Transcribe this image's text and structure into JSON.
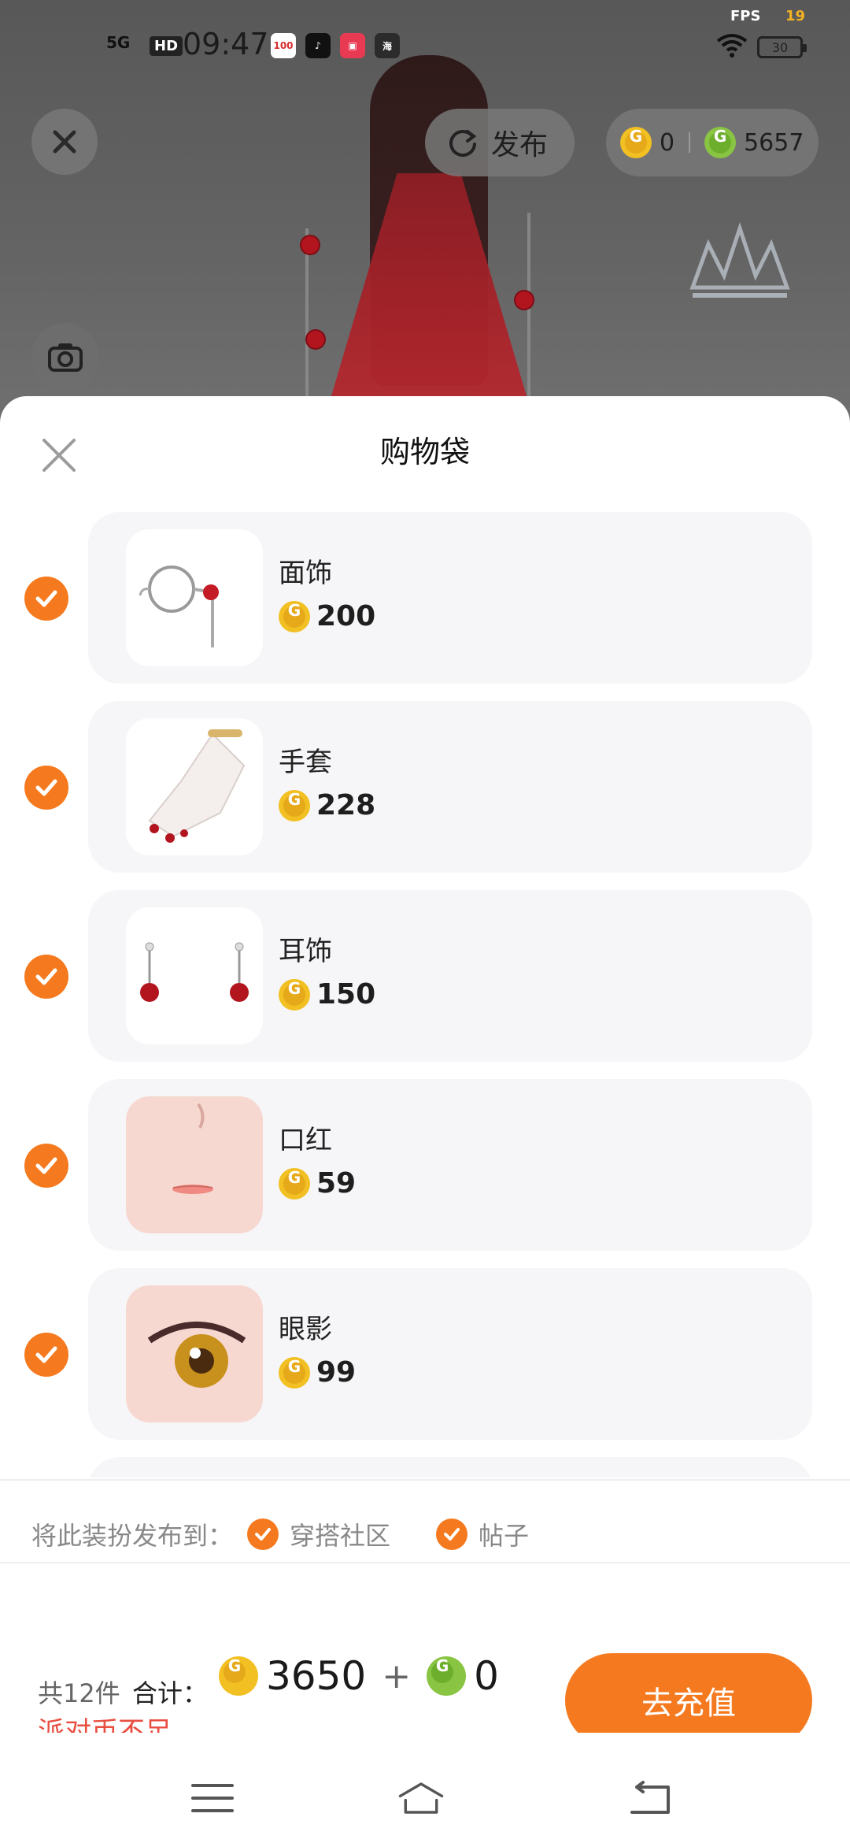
{
  "status_bar": {
    "network": "5G",
    "hd": "HD",
    "time": "09:47",
    "fps_label": "FPS",
    "fps_value": "19",
    "battery": "30",
    "apps": [
      "100",
      "tiktok",
      "video",
      "海"
    ]
  },
  "top_bar": {
    "publish_label": "发布",
    "balance_gold": "0",
    "balance_green": "5657"
  },
  "sheet": {
    "title": "购物袋",
    "items": [
      {
        "name": "面饰",
        "price": "200"
      },
      {
        "name": "手套",
        "price": "228"
      },
      {
        "name": "耳饰",
        "price": "150"
      },
      {
        "name": "口红",
        "price": "59"
      },
      {
        "name": "眼影",
        "price": "99"
      }
    ],
    "publish_to_label": "将此装扮发布到：",
    "publish_options": [
      "穿搭社区",
      "帖子"
    ]
  },
  "footer": {
    "count": "共12件",
    "total_label": "合计：",
    "total_gold": "3650",
    "plus": "+",
    "total_green": "0",
    "warning": "派对币不足",
    "recharge_button": "去充值"
  },
  "colors": {
    "accent": "#f57a1f",
    "warning": "#e84e40",
    "coin_gold": "#f2c023",
    "coin_green": "#89c443"
  },
  "icons": [
    "close-icon",
    "refresh-icon",
    "camera-icon",
    "check-icon",
    "coin-icon",
    "menu-icon",
    "home-icon",
    "back-icon"
  ]
}
